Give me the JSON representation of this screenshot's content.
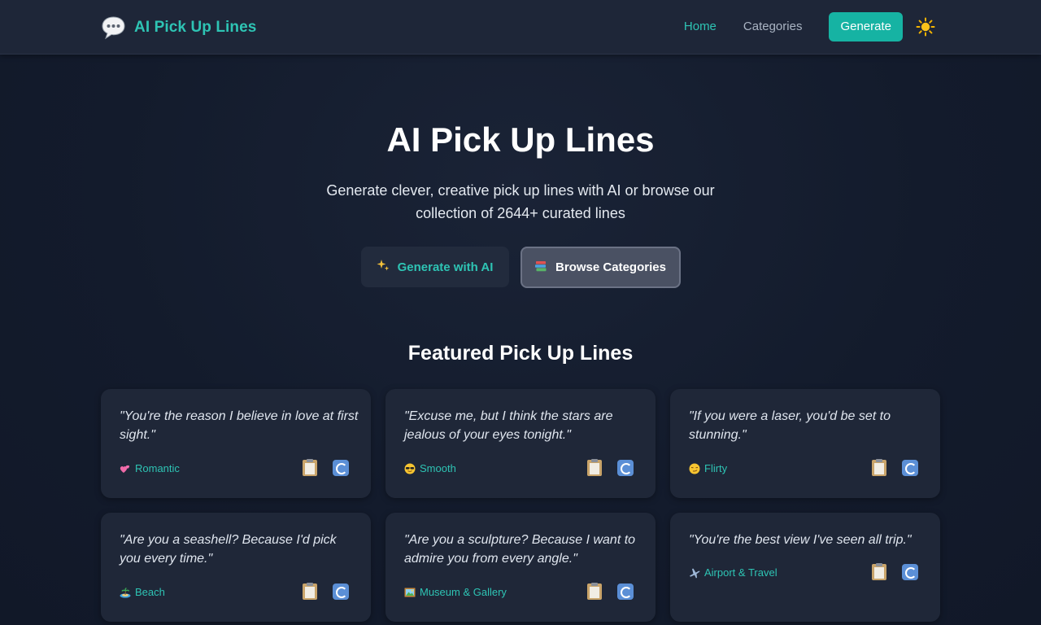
{
  "header": {
    "brand_title": "AI Pick Up Lines",
    "nav": {
      "home": "Home",
      "categories": "Categories",
      "generate": "Generate"
    }
  },
  "hero": {
    "title": "AI Pick Up Lines",
    "subtitle": "Generate clever, creative pick up lines with AI or browse our collection of 2644+ curated lines",
    "generate_label": "Generate with AI",
    "browse_label": "Browse Categories"
  },
  "featured": {
    "title": "Featured Pick Up Lines",
    "cards": [
      {
        "quote": "\"You're the reason I believe in love at first sight.\"",
        "category": "Romantic",
        "icon": "sparkling-hearts-icon"
      },
      {
        "quote": "\"Excuse me, but I think the stars are jealous of your eyes tonight.\"",
        "category": "Smooth",
        "icon": "sunglasses-face-icon"
      },
      {
        "quote": "\"If you were a laser, you'd be set to stunning.\"",
        "category": "Flirty",
        "icon": "smirking-face-icon"
      },
      {
        "quote": "\"Are you a seashell? Because I'd pick you every time.\"",
        "category": "Beach",
        "icon": "island-icon"
      },
      {
        "quote": "\"Are you a sculpture? Because I want to admire you from every angle.\"",
        "category": "Museum & Gallery",
        "icon": "framed-picture-icon"
      },
      {
        "quote": "\"You're the best view I've seen all trip.\"",
        "category": "Airport & Travel",
        "icon": "airplane-icon"
      }
    ]
  },
  "colors": {
    "accent": "#16b3a3",
    "accent_text": "#2ec4b4",
    "card_bg": "#1f2738",
    "page_bg": "#131b2c"
  }
}
